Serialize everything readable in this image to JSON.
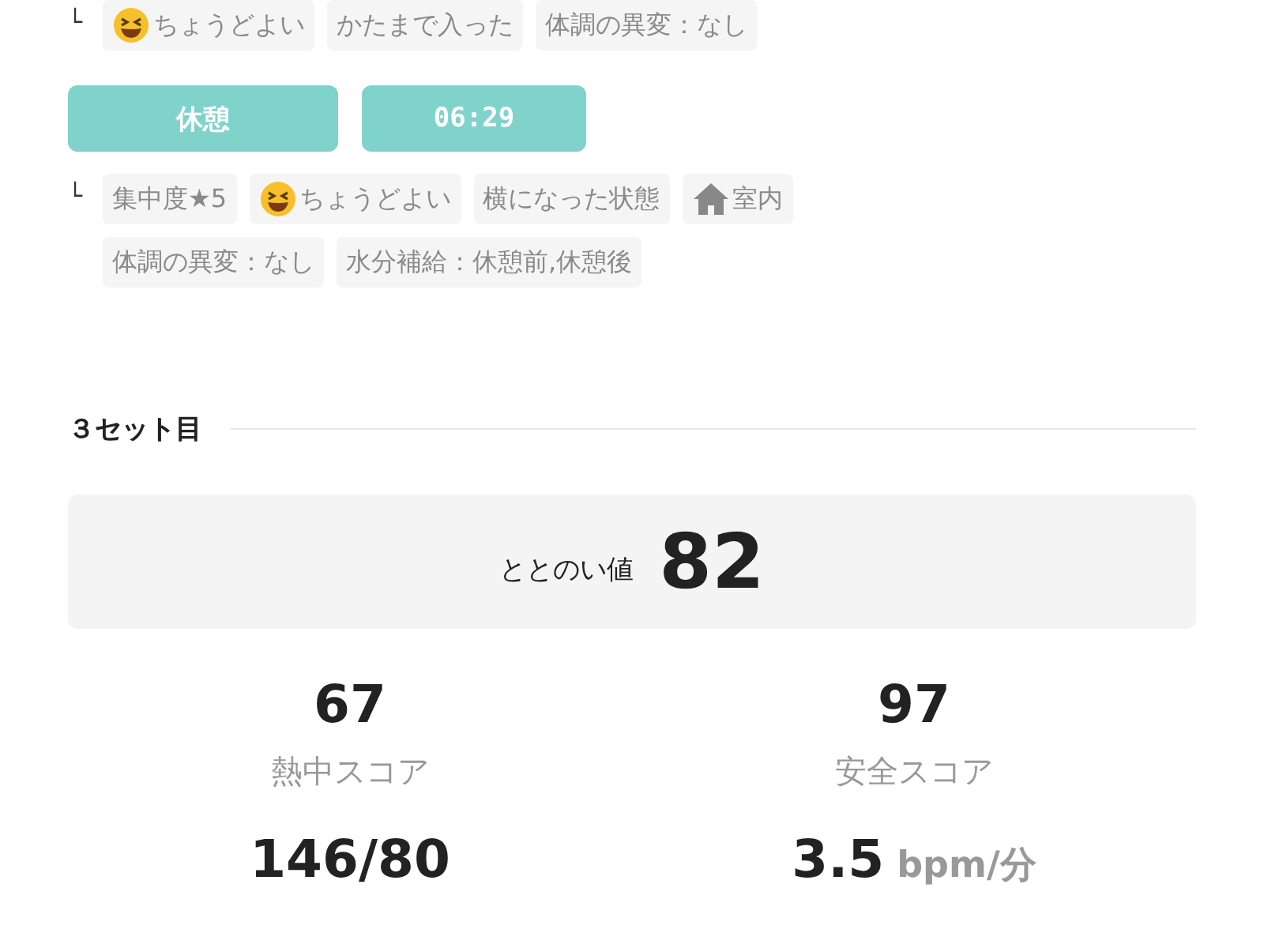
{
  "prev_tags": [
    {
      "kind": "mood",
      "text": "ちょうどよい"
    },
    {
      "kind": "plain",
      "text": "かたまで入った"
    },
    {
      "kind": "plain",
      "text": "体調の異変：なし"
    }
  ],
  "phase": {
    "label": "休憩",
    "time": "06:29"
  },
  "tree_mark": "└",
  "tags": [
    {
      "kind": "plain",
      "text": "集中度★5"
    },
    {
      "kind": "mood",
      "text": "ちょうどよい"
    },
    {
      "kind": "plain",
      "text": "横になった状態"
    },
    {
      "kind": "indoor",
      "text": "室内"
    },
    {
      "kind": "plain",
      "text": "体調の異変：なし"
    },
    {
      "kind": "plain",
      "text": "水分補給：休憩前,休憩後"
    }
  ],
  "section_title": "３セット目",
  "totonoi": {
    "label": "ととのい値",
    "value": "82"
  },
  "stats": [
    {
      "value": "67",
      "label": "熱中スコア"
    },
    {
      "value": "97",
      "label": "安全スコア"
    },
    {
      "value": "146/80"
    },
    {
      "value": "3.5",
      "unit": "bpm/分"
    }
  ]
}
